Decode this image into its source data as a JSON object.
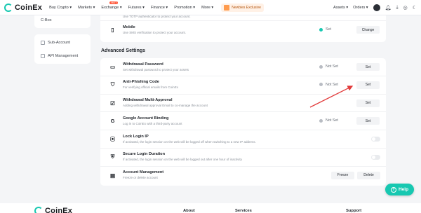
{
  "nav": {
    "logo": "CoinEx",
    "items": [
      "Buy Crypto ▾",
      "Markets ▾",
      "Exchange ▾",
      "Futures ▾",
      "Finance ▾",
      "Promotion ▾",
      "More ▾"
    ],
    "hot_badge": "HOT",
    "promo": "Newbies Exclusive",
    "assets": "Assets ▾",
    "orders": "Orders ▾"
  },
  "sidebar": {
    "top_item": "C-Box",
    "items": [
      "Sub-Account",
      "API Management"
    ]
  },
  "top_rows": [
    {
      "title": "",
      "desc": "Use TOTP authenticator to protect your account.",
      "status": "",
      "button": ""
    },
    {
      "title": "Mobile",
      "desc": "Use SMS verification to protect your account.",
      "status": "Set",
      "button": "Change"
    }
  ],
  "advanced": {
    "title": "Advanced Settings",
    "rows": [
      {
        "title": "Withdrawal Password",
        "desc": "Set withdrawal password to protect your assets",
        "status": "Not Set",
        "button": "Set"
      },
      {
        "title": "Anti-Phishing Code",
        "desc": "For verifying official emails from CoinEx",
        "status": "Not Set",
        "button": "Set"
      },
      {
        "title": "Withdrawal Multi-Approval",
        "desc": "Adding withdrawal approval Email to co-manage the account",
        "status": "",
        "button": "Set"
      },
      {
        "title": "Google Account Binding",
        "desc": "Log in to CoinEx with a third-party account",
        "status": "Not Set",
        "button": "Set"
      },
      {
        "title": "Lock Login IP",
        "desc": "If activated, the login session on the web will be logged off when switching to a new IP address.",
        "status": "",
        "button": ""
      },
      {
        "title": "Secure Login Duration",
        "desc": "If activated, the login session on the web will be logged out after one hour of inactivity",
        "status": "",
        "button": ""
      },
      {
        "title": "Account Management",
        "desc": "Freeze or delete account",
        "buttons": [
          "Freeze",
          "Delete"
        ]
      }
    ]
  },
  "help": "Help",
  "footer": {
    "logo": "CoinEx",
    "cols": [
      "About",
      "Services",
      "Support"
    ]
  },
  "colors": {
    "accent": "#17c8b1",
    "arrow": "#e23b3b"
  }
}
